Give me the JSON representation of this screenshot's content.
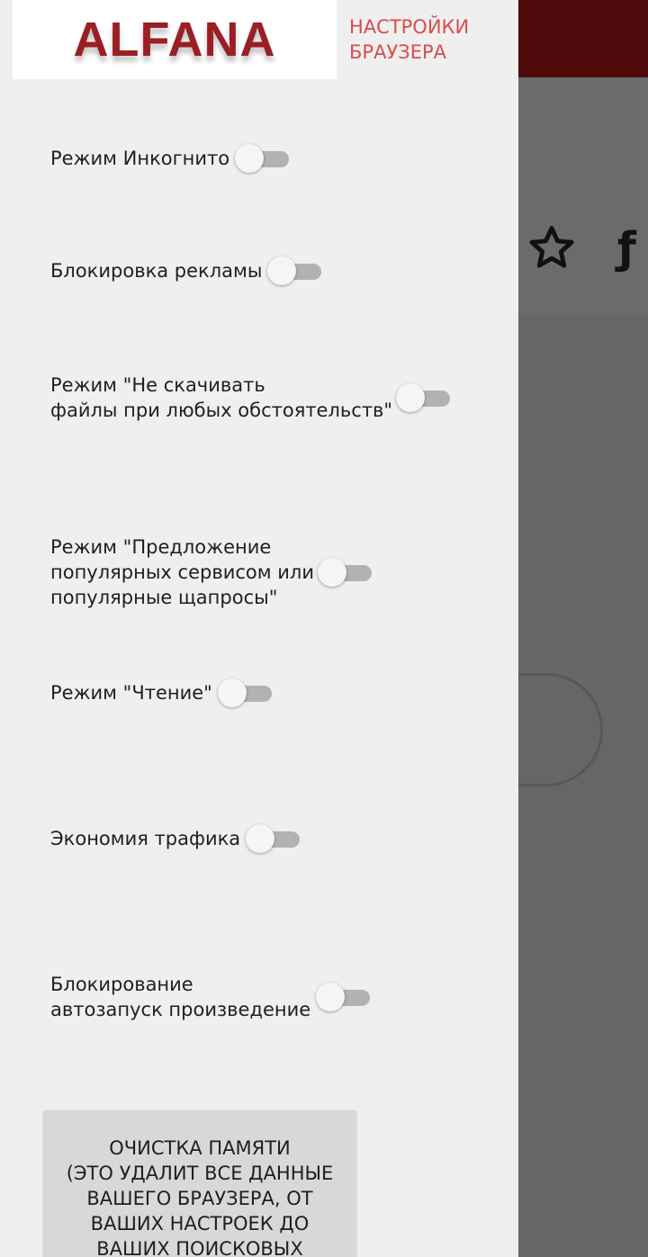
{
  "header": {
    "logo_text": "ALFANA",
    "title": "НАСТРОЙКИ\nБРАУЗЕРА"
  },
  "settings": [
    {
      "label": "Режим Инкогнито",
      "enabled": false
    },
    {
      "label": "Блокировка рекламы",
      "enabled": false
    },
    {
      "label": "Режим \"Не скачивать\nфайлы при любых обстоятельств\"",
      "enabled": false
    },
    {
      "label": "Режим \"Предложение\nпопулярных сервисом или\nпопулярные щапросы\"",
      "enabled": false
    },
    {
      "label": "Режим \"Чтение\"",
      "enabled": false
    },
    {
      "label": "Экономия трафика",
      "enabled": false
    },
    {
      "label": "Блокирование\nавтозапуск произведение",
      "enabled": false
    }
  ],
  "clear_button": {
    "label": "ОЧИСТКА ПАМЯТИ\n(ЭТО УДАЛИТ ВСЕ ДАННЫЕ\nВАШЕГО БРАУЗЕРА, ОТ\nВАШИХ НАСТРОЕК ДО\nВАШИХ ПОИСКОВЫХ"
  },
  "background_app": {
    "toolbar_icons": [
      "star-icon"
    ],
    "topbar_color": "#4f0b0c"
  },
  "colors": {
    "accent": "#d94c4c",
    "brand": "#9a1f24",
    "switch_track_off": "#b2b2b2"
  }
}
